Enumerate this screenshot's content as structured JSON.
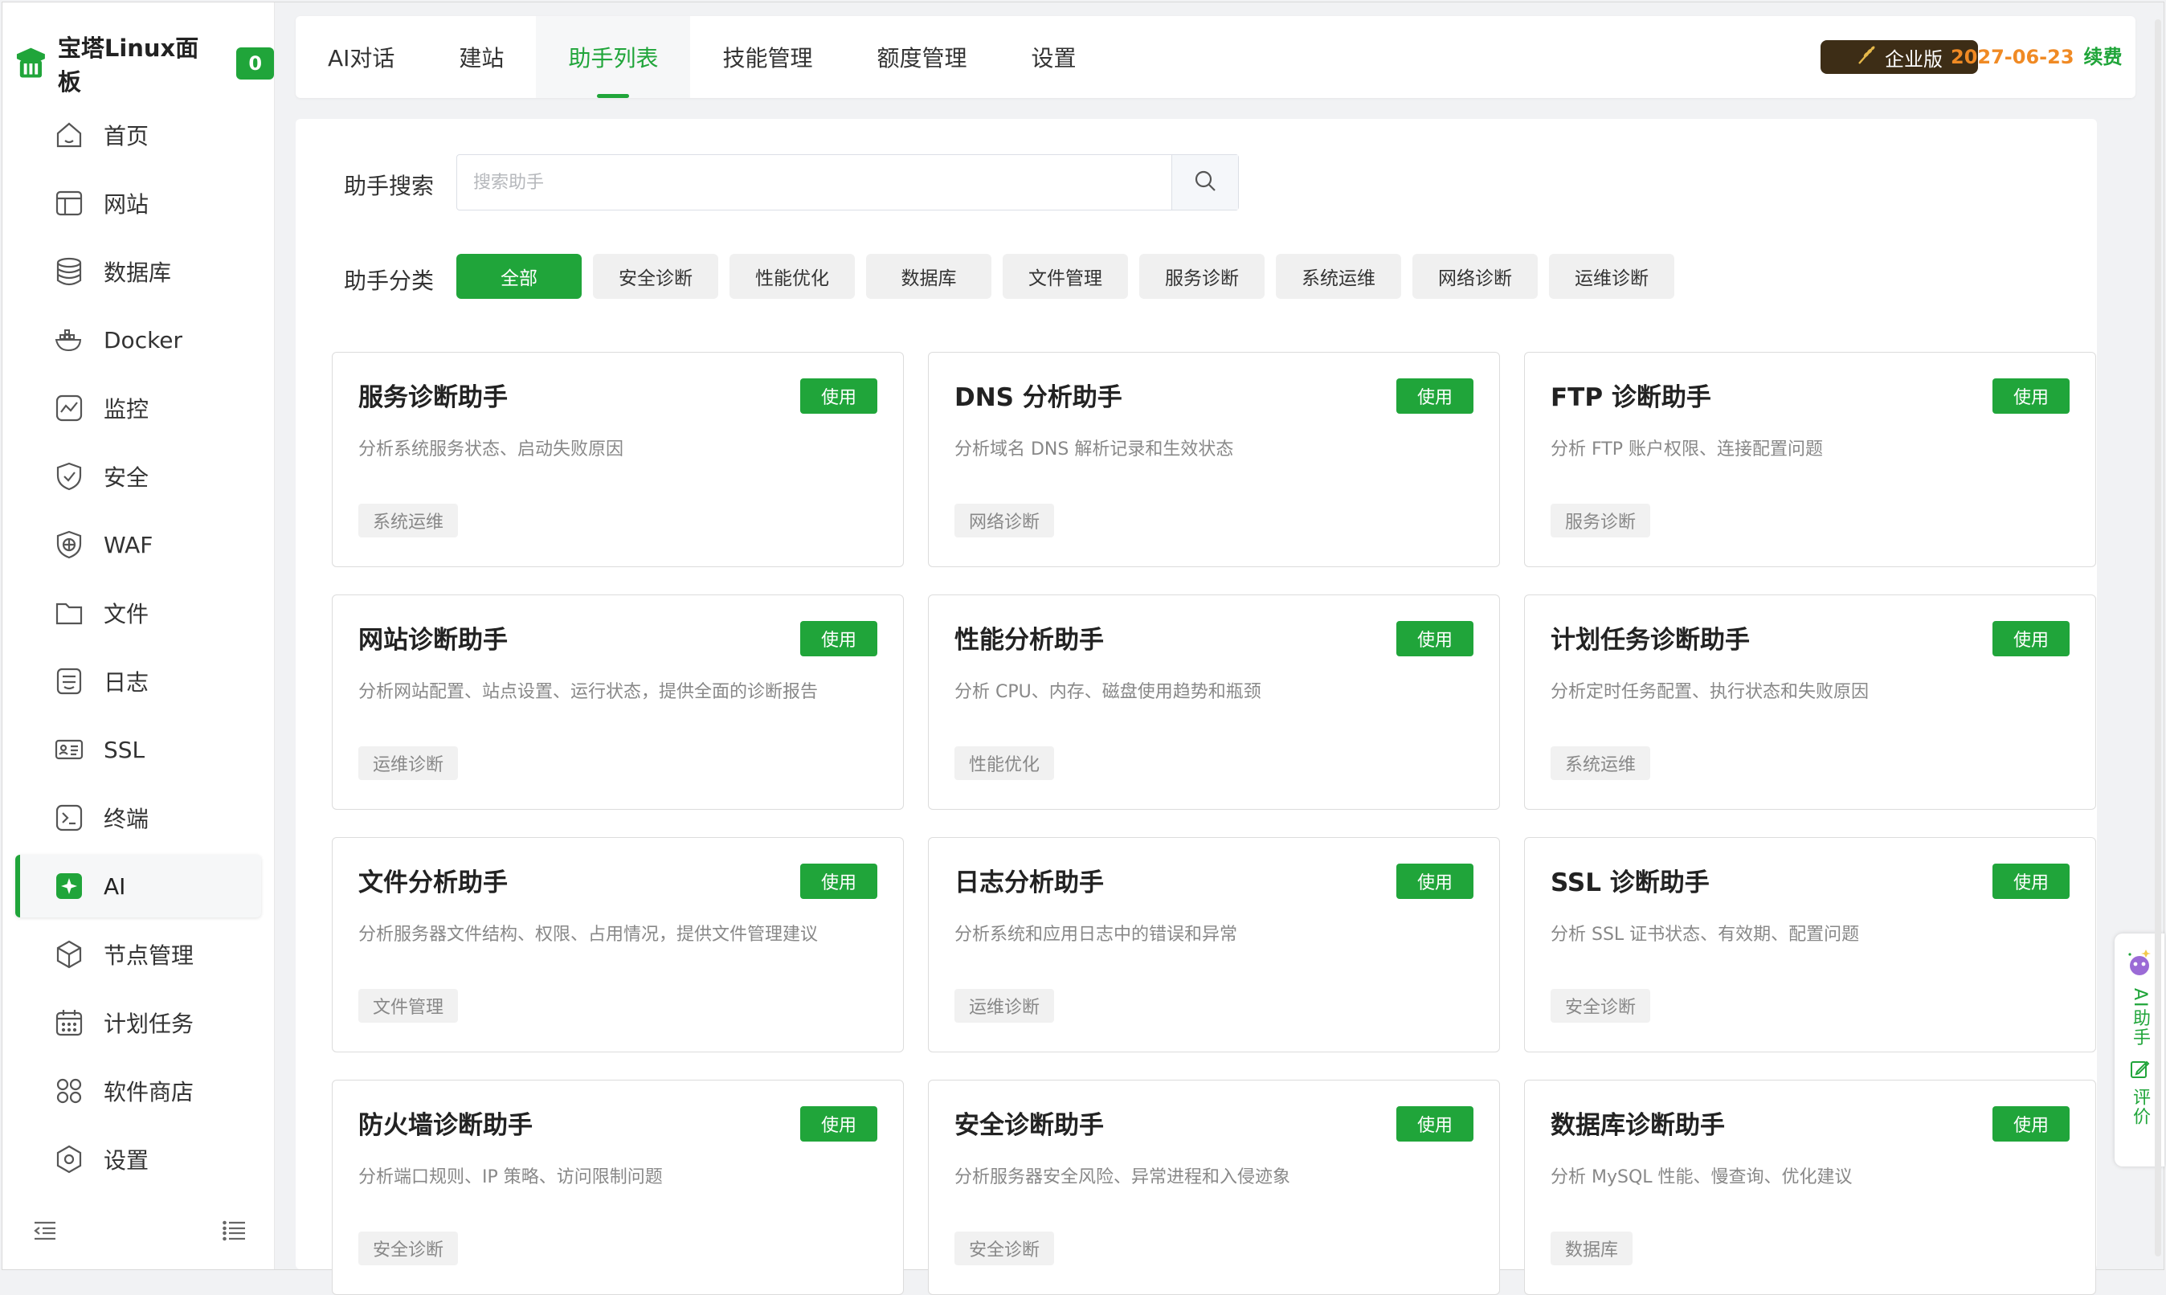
{
  "brand": {
    "title": "宝塔Linux面板",
    "badge": "0"
  },
  "sidebar": {
    "items": [
      {
        "label": "首页",
        "icon": "home-icon"
      },
      {
        "label": "网站",
        "icon": "website-icon"
      },
      {
        "label": "数据库",
        "icon": "database-icon"
      },
      {
        "label": "Docker",
        "icon": "docker-icon"
      },
      {
        "label": "监控",
        "icon": "monitor-icon"
      },
      {
        "label": "安全",
        "icon": "shield-icon"
      },
      {
        "label": "WAF",
        "icon": "waf-icon"
      },
      {
        "label": "文件",
        "icon": "folder-icon"
      },
      {
        "label": "日志",
        "icon": "log-icon"
      },
      {
        "label": "SSL",
        "icon": "ssl-icon"
      },
      {
        "label": "终端",
        "icon": "terminal-icon"
      },
      {
        "label": "AI",
        "icon": "ai-icon",
        "active": true
      },
      {
        "label": "节点管理",
        "icon": "node-icon"
      },
      {
        "label": "计划任务",
        "icon": "calendar-icon"
      },
      {
        "label": "软件商店",
        "icon": "apps-icon"
      },
      {
        "label": "设置",
        "icon": "settings-icon"
      }
    ]
  },
  "tabs": [
    {
      "label": "AI对话"
    },
    {
      "label": "建站"
    },
    {
      "label": "助手列表",
      "active": true
    },
    {
      "label": "技能管理"
    },
    {
      "label": "额度管理"
    },
    {
      "label": "设置"
    }
  ],
  "header": {
    "edition": "企业版",
    "expire_date": "2027-06-23",
    "renew": "续费"
  },
  "search": {
    "label": "助手搜索",
    "placeholder": "搜索助手"
  },
  "categories": {
    "label": "助手分类",
    "items": [
      "全部",
      "安全诊断",
      "性能优化",
      "数据库",
      "文件管理",
      "服务诊断",
      "系统运维",
      "网络诊断",
      "运维诊断"
    ]
  },
  "use_label": "使用",
  "cards": [
    {
      "name": "服务诊断助手",
      "desc": "分析系统服务状态、启动失败原因",
      "tag": "系统运维"
    },
    {
      "name": "DNS 分析助手",
      "desc": "分析域名 DNS 解析记录和生效状态",
      "tag": "网络诊断"
    },
    {
      "name": "FTP 诊断助手",
      "desc": "分析 FTP 账户权限、连接配置问题",
      "tag": "服务诊断"
    },
    {
      "name": "网站诊断助手",
      "desc": "分析网站配置、站点设置、运行状态，提供全面的诊断报告",
      "tag": "运维诊断"
    },
    {
      "name": "性能分析助手",
      "desc": "分析 CPU、内存、磁盘使用趋势和瓶颈",
      "tag": "性能优化"
    },
    {
      "name": "计划任务诊断助手",
      "desc": "分析定时任务配置、执行状态和失败原因",
      "tag": "系统运维"
    },
    {
      "name": "文件分析助手",
      "desc": "分析服务器文件结构、权限、占用情况，提供文件管理建议",
      "tag": "文件管理"
    },
    {
      "name": "日志分析助手",
      "desc": "分析系统和应用日志中的错误和异常",
      "tag": "运维诊断"
    },
    {
      "name": "SSL 诊断助手",
      "desc": "分析 SSL 证书状态、有效期、配置问题",
      "tag": "安全诊断"
    },
    {
      "name": "防火墙诊断助手",
      "desc": "分析端口规则、IP 策略、访问限制问题",
      "tag": "安全诊断"
    },
    {
      "name": "安全诊断助手",
      "desc": "分析服务器安全风险、异常进程和入侵迹象",
      "tag": "安全诊断"
    },
    {
      "name": "数据库诊断助手",
      "desc": "分析 MySQL 性能、慢查询、优化建议",
      "tag": "数据库"
    }
  ],
  "float_widget": {
    "ai_label": "AI助手",
    "rate_label": "评价"
  },
  "colors": {
    "brand_green": "#20a53a",
    "expire_orange": "#f08a24",
    "edition_bg": "#3d2d16"
  }
}
